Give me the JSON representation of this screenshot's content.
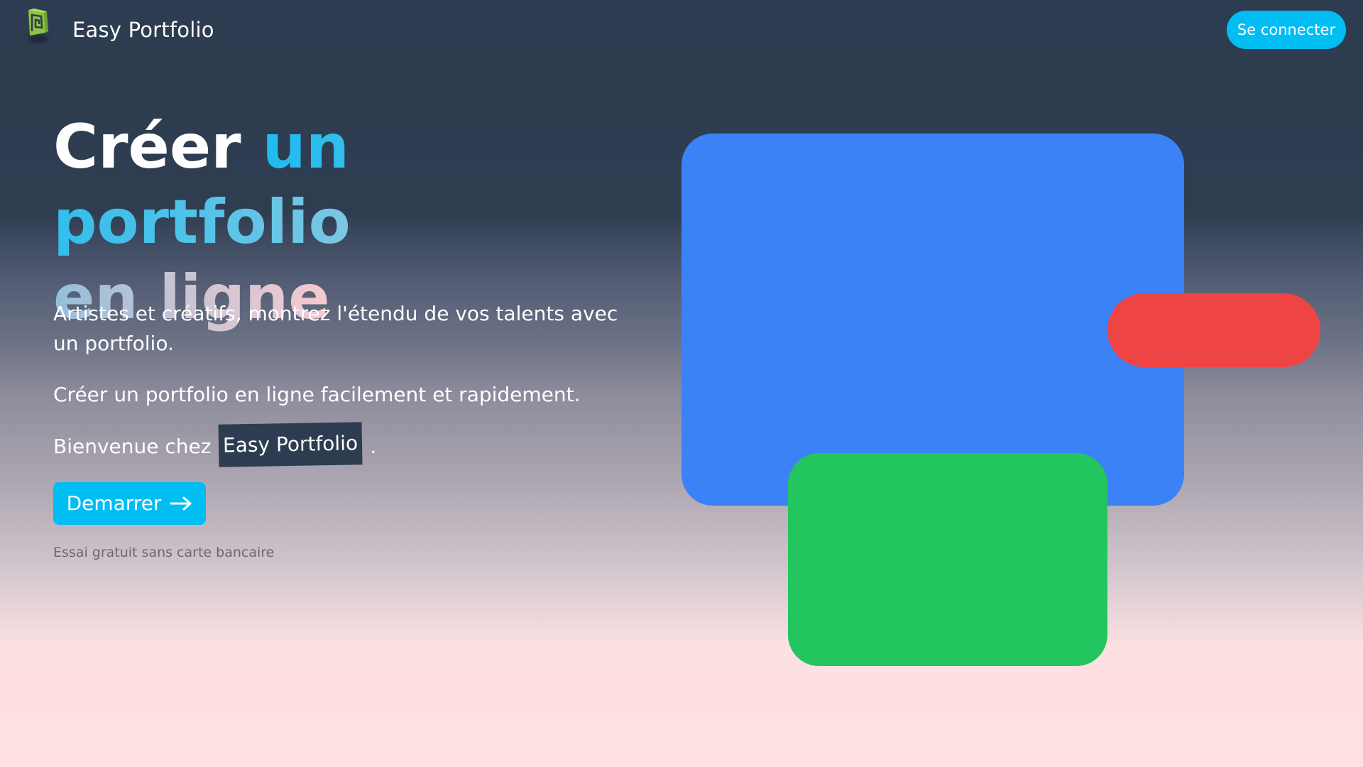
{
  "header": {
    "brand": "Easy Portfolio",
    "login_label": "Se connecter",
    "logo_icon": "spiral-square-logo-icon",
    "colors": {
      "logo": "#8dc63f",
      "button": "#00bdf2"
    }
  },
  "hero": {
    "title": {
      "part1": "Créer",
      "part2": "un portfolio",
      "part3": "en ligne"
    },
    "para1": "Artistes et créatifs, montrez l'étendu de vos talents avec un portfolio.",
    "para2": "Créer un portfolio en ligne facilement et rapidement.",
    "para3": {
      "before": "Bienvenue chez",
      "highlight": "Easy Portfolio",
      "after": "."
    },
    "start_label": "Demarrer",
    "start_icon": "arrow-right-icon",
    "note": "Essai gratuit sans carte bancaire"
  },
  "illustration": {
    "colors": {
      "blue": "#3b82f6",
      "red": "#ef4444",
      "green": "#22c55e"
    }
  }
}
